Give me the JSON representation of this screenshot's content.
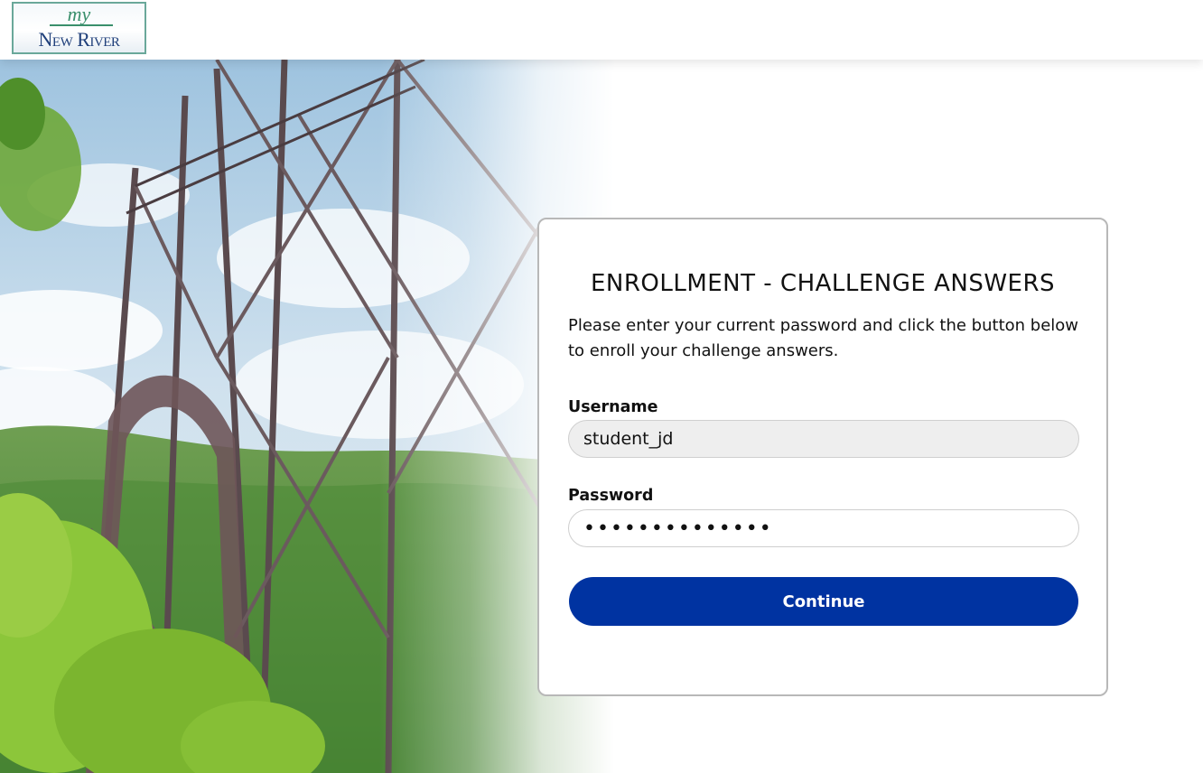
{
  "header": {
    "logo_top": "my",
    "logo_bottom": "New River"
  },
  "card": {
    "title": "ENROLLMENT - CHALLENGE ANSWERS",
    "description": "Please enter your current password and click the button below to enroll your challenge answers.",
    "username_label": "Username",
    "username_value": "student_jd",
    "password_label": "Password",
    "password_value": "••••••••••••••",
    "continue_label": "Continue"
  },
  "colors": {
    "button": "#0033a1",
    "logo_text": "#1f3f7a",
    "logo_accent": "#3a8f6c",
    "card_border": "#b8b8b8"
  }
}
